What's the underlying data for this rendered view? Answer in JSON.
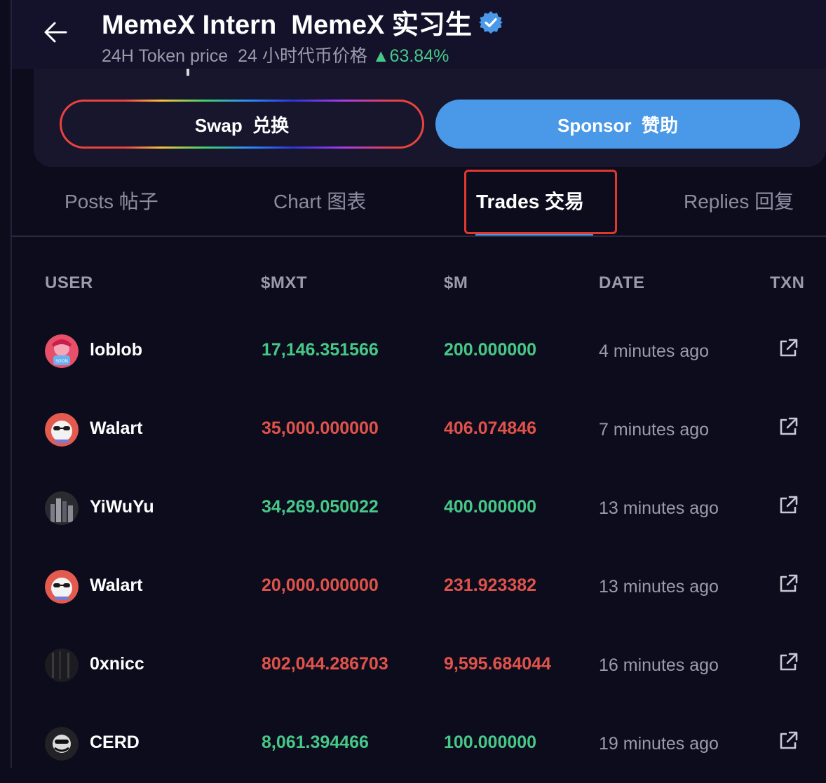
{
  "header": {
    "title": "MemeX Intern  MemeX 实习生",
    "subtitle_label": "24H Token price  24 小时代币价格",
    "subtitle_change": "▲63.84%",
    "verified_icon": "verified-badge-icon",
    "accent": "#4a98e8"
  },
  "actions": {
    "swap_label": "Swap  兑换",
    "sponsor_label": "Sponsor  赞助"
  },
  "tabs": [
    {
      "label": "Posts  帖子"
    },
    {
      "label": "Chart  图表"
    },
    {
      "label": "Trades  交易",
      "active": true
    },
    {
      "label": "Replies  回复"
    }
  ],
  "table": {
    "columns": [
      "USER",
      "$MXT",
      "$M",
      "DATE",
      "TXN"
    ],
    "rows": [
      {
        "user": "loblob",
        "mxt": "17,146.351566",
        "m": "200.000000",
        "date": "4 minutes ago",
        "side": "buy"
      },
      {
        "user": "Walart",
        "mxt": "35,000.000000",
        "m": "406.074846",
        "date": "7 minutes ago",
        "side": "sell"
      },
      {
        "user": "YiWuYu",
        "mxt": "34,269.050022",
        "m": "400.000000",
        "date": "13 minutes ago",
        "side": "buy"
      },
      {
        "user": "Walart",
        "mxt": "20,000.000000",
        "m": "231.923382",
        "date": "13 minutes ago",
        "side": "sell"
      },
      {
        "user": "0xnicc",
        "mxt": "802,044.286703",
        "m": "9,595.684044",
        "date": "16 minutes ago",
        "side": "sell"
      },
      {
        "user": "CERD",
        "mxt": "8,061.394466",
        "m": "100.000000",
        "date": "19 minutes ago",
        "side": "buy"
      }
    ],
    "colors": {
      "buy": "#46c887",
      "sell": "#e0534a"
    }
  }
}
